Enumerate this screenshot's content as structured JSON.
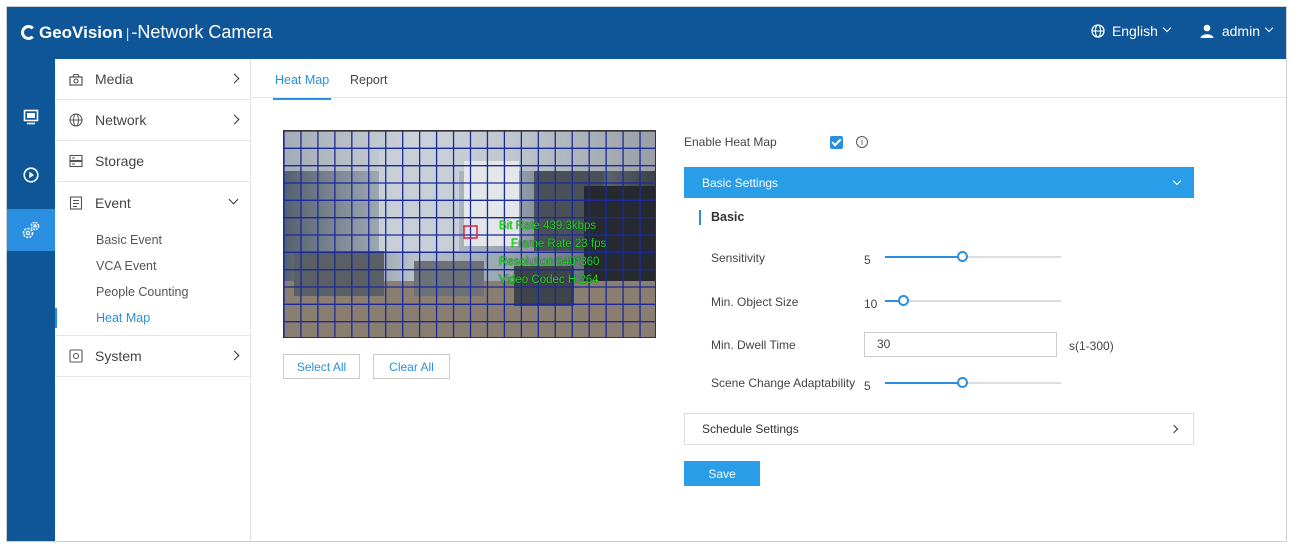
{
  "header": {
    "brand_name": "GeoVision",
    "separator": "|",
    "title": "-Network Camera",
    "language": "English",
    "user": "admin"
  },
  "rail": [
    {
      "icon": "monitor-icon"
    },
    {
      "icon": "playback-icon"
    },
    {
      "icon": "settings-gear-icon",
      "active": true
    }
  ],
  "sidebar": {
    "media": "Media",
    "network": "Network",
    "storage": "Storage",
    "event": "Event",
    "event_items": [
      "Basic Event",
      "VCA Event",
      "People Counting",
      "Heat Map"
    ],
    "active_item": "Heat Map",
    "system": "System"
  },
  "tabs": [
    "Heat Map",
    "Report"
  ],
  "video": {
    "overlay_lines": [
      "Bit Rate 439.3kbps",
      "Frame Rate 23 fps",
      "Resolution 640*360",
      "Video Codec H.264"
    ]
  },
  "buttons": {
    "select_all": "Select All",
    "clear_all": "Clear All",
    "save": "Save"
  },
  "settings": {
    "enable_label": "Enable Heat Map",
    "enable_checked": true,
    "info_icon": "i",
    "basic_settings": "Basic Settings",
    "basic_title": "Basic",
    "sensitivity_label": "Sensitivity",
    "sensitivity_value": "5",
    "sensitivity_fraction": 0.44,
    "min_object_label": "Min. Object Size",
    "min_object_value": "10",
    "min_object_fraction": 0.1,
    "dwell_label": "Min. Dwell Time",
    "dwell_value": "30",
    "dwell_unit": "s(1-300)",
    "scene_label": "Scene Change Adaptability",
    "scene_value": "5",
    "scene_fraction": 0.44,
    "schedule_settings": "Schedule Settings"
  }
}
